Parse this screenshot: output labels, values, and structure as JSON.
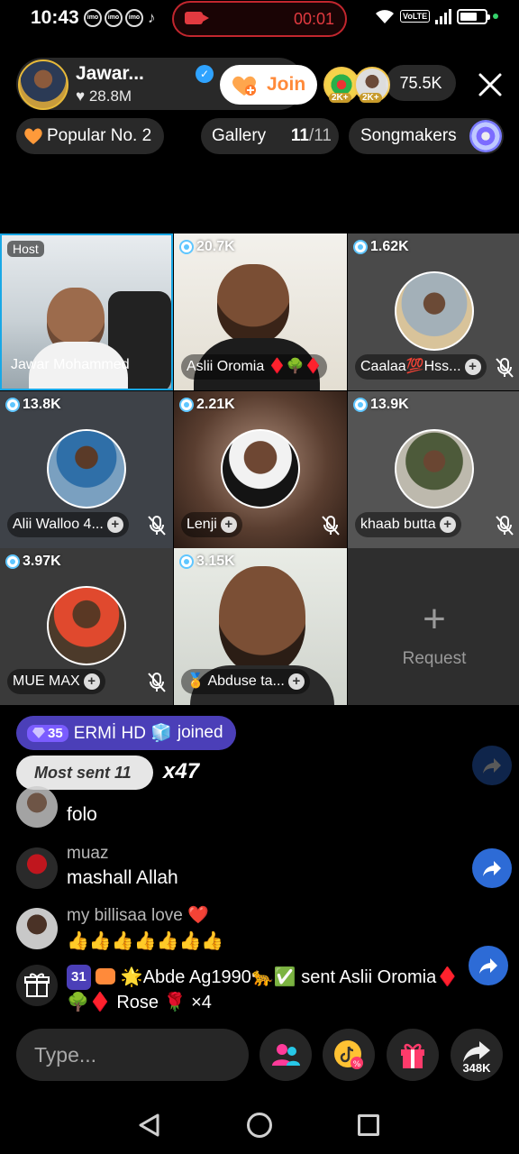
{
  "status_bar": {
    "time": "10:43",
    "app_icons": [
      "imo",
      "imo",
      "imo"
    ],
    "recording_time": "00:01",
    "volte": "VoLTE"
  },
  "host": {
    "name": "Jawar...",
    "likes": "28.8M",
    "join_label": "Join",
    "viewer_badges": [
      "2K+",
      "2K+"
    ],
    "viewer_count": "75.5K"
  },
  "pills": {
    "popular": "Popular No. 2",
    "gallery_label": "Gallery",
    "gallery_current": "11",
    "gallery_total": "/11",
    "songmakers": "Songmakers"
  },
  "grid": {
    "host_tag": "Host",
    "tiles": [
      {
        "count": "",
        "name": "Jawar Mohammed"
      },
      {
        "count": "20.7K",
        "name": "Aslii Oromia ♦️🌳♦️"
      },
      {
        "count": "1.62K",
        "name": "Caalaa💯Hss..."
      },
      {
        "count": "13.8K",
        "name": "Alii Walloo 4..."
      },
      {
        "count": "2.21K",
        "name": "Lenji"
      },
      {
        "count": "13.9K",
        "name": "khaab butta"
      },
      {
        "count": "3.97K",
        "name": "MUE MAX"
      },
      {
        "count": "3.15K",
        "name": "🏅 Abduse ta..."
      }
    ],
    "request_label": "Request",
    "request_plus": "+"
  },
  "chat": {
    "join_notice": {
      "level": "35",
      "user": "ERMİ HD 🧊",
      "action": "joined"
    },
    "most_sent": "Most sent 11",
    "multiplier": "x47",
    "messages": [
      {
        "user": "",
        "text": "folo"
      },
      {
        "user": "muaz",
        "text": "mashall Allah"
      },
      {
        "user": "my billisaa love ❤️",
        "text": "👍👍👍👍👍👍👍"
      }
    ],
    "gift": {
      "level": "31",
      "text": "🌟Abde Ag1990🐆✅ sent Aslii Oromia♦️🌳♦️ Rose 🌹 ×4"
    }
  },
  "bottom_bar": {
    "type_placeholder": "Type...",
    "share_count": "348K"
  },
  "colors": {
    "accent_blue": "#2d6bd6",
    "join_orange": "#ff8a3a",
    "record_red": "#e23a40",
    "notice_purple": "#4b3fb8",
    "gift_pink": "#ff3b6b"
  }
}
